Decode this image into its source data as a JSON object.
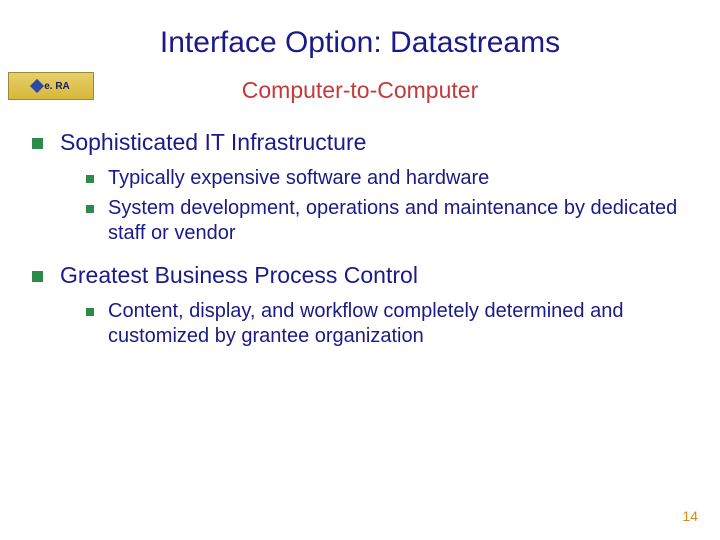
{
  "title": "Interface Option: Datastreams",
  "subtitle": "Computer-to-Computer",
  "logo_text": "e. RA",
  "bullets": {
    "b1": "Sophisticated IT Infrastructure",
    "b1_1": "Typically expensive software and hardware",
    "b1_2": "System development, operations and maintenance by dedicated staff or vendor",
    "b2": "Greatest Business Process Control",
    "b2_1": "Content, display, and workflow completely determined and customized by grantee organization"
  },
  "page_number": "14"
}
